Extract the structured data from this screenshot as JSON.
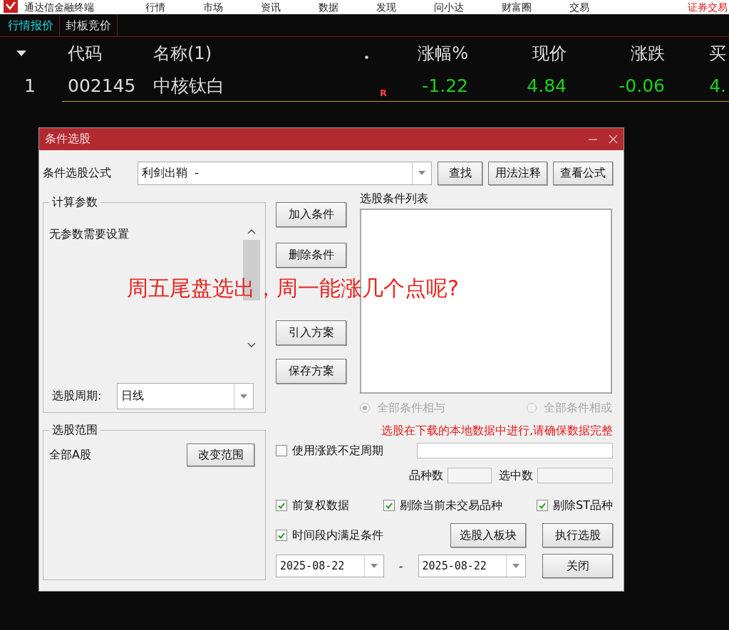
{
  "menu_bar": {
    "app_title": "通达信金融终端",
    "items": [
      "行情",
      "市场",
      "资讯",
      "数据",
      "发现",
      "问小达",
      "财富圈",
      "交易"
    ],
    "right_link": "证券交易"
  },
  "tabs": [
    {
      "label": "行情报价",
      "selected": true
    },
    {
      "label": "封板竞价",
      "selected": false
    }
  ],
  "quote_table": {
    "columns": [
      "代码",
      "名称(1)",
      "涨幅%",
      "现价",
      "涨跌",
      "买"
    ],
    "rows": [
      {
        "index": "1",
        "code": "002145",
        "name": "中核钛白",
        "flag": "R",
        "change_pct": "-1.22",
        "price": "4.84",
        "change": "-0.06",
        "column_8": "4."
      }
    ]
  },
  "dialog": {
    "title": "条件选股",
    "formula_label": "条件选股公式",
    "formula_value": "利剑出鞘  -",
    "top_buttons": [
      "查找",
      "用法注释",
      "查看公式"
    ],
    "params_group": {
      "title": "计算参数",
      "text": "无参数需要设置",
      "period_label": "选股周期:",
      "period_value": "日线"
    },
    "side_buttons": [
      "加入条件",
      "删除条件",
      "引入方案",
      "保存方案"
    ],
    "list_title": "选股条件列表",
    "radios": [
      {
        "label": "全部条件相与",
        "selected": true,
        "disabled": true
      },
      {
        "label": "全部条件相或",
        "selected": false,
        "disabled": true
      }
    ],
    "range_group": {
      "title": "选股范围",
      "value": "全部A股",
      "button": "改变范围"
    },
    "warning": "选股在下载的本地数据中进行,请确保数据完整",
    "variable_period": {
      "label": "使用涨跌不定周期",
      "checked": false
    },
    "count_labels": [
      "品种数",
      "选中数"
    ],
    "options": [
      {
        "label": "前复权数据",
        "checked": true
      },
      {
        "label": "剔除当前未交易品种",
        "checked": true
      },
      {
        "label": "剔除ST品种",
        "checked": true
      }
    ],
    "time_range": {
      "label": "时间段内满足条件",
      "checked": true
    },
    "action_buttons": [
      "选股入板块",
      "执行选股"
    ],
    "date_from": "2025-08-22",
    "date_separator": "-",
    "date_to": "2025-08-22",
    "close_button": "关闭"
  },
  "overlay_caption": "周五尾盘选出，周一能涨几个点呢?"
}
